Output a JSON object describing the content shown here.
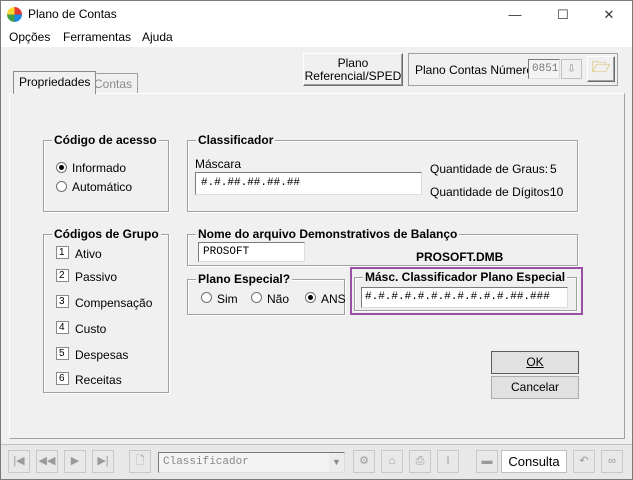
{
  "window": {
    "title": "Plano de Contas",
    "minimize_glyph": "—",
    "maximize_glyph": "☐",
    "close_glyph": "✕"
  },
  "menu": [
    "Opções",
    "Ferramentas",
    "Ajuda"
  ],
  "toolbar": {
    "ref_button_line1": "Plano",
    "ref_button_line2": "Referencial/SPED",
    "numero_label": "Plano Contas Número",
    "numero_value": "0851"
  },
  "tabs": [
    {
      "label": "Propriedades",
      "active": true
    },
    {
      "label": "Contas",
      "active": false
    }
  ],
  "codigo_acesso": {
    "title": "Código de acesso",
    "options": [
      {
        "label": "Informado",
        "checked": true
      },
      {
        "label": "Automático",
        "checked": false
      }
    ]
  },
  "classificador": {
    "title": "Classificador",
    "mascara_label": "Máscara",
    "mascara_value": "#.#.##.##.##.##",
    "graus_label": "Quantidade de Graus:",
    "graus_value": "5",
    "digitos_label": "Quantidade de Dígitos:",
    "digitos_value": "10"
  },
  "codigos_grupo": {
    "title": "Códigos de Grupo",
    "items": [
      {
        "num": "1",
        "label": "Ativo"
      },
      {
        "num": "2",
        "label": "Passivo"
      },
      {
        "num": "3",
        "label": "Compensação"
      },
      {
        "num": "4",
        "label": "Custo"
      },
      {
        "num": "5",
        "label": "Despesas"
      },
      {
        "num": "6",
        "label": "Receitas"
      }
    ]
  },
  "demonstrativos": {
    "title": "Nome do arquivo Demonstrativos de Balanço",
    "input_value": "PROSOFT",
    "file_name": "PROSOFT.DMB"
  },
  "plano_especial": {
    "title": "Plano Especial?",
    "options": [
      {
        "label": "Sim",
        "checked": false
      },
      {
        "label": "Não",
        "checked": false
      },
      {
        "label": "ANS",
        "checked": true
      }
    ]
  },
  "masc_especial": {
    "title": "Másc. Classificador Plano Especial",
    "value": "#.#.#.#.#.#.#.#.#.#.#.##.###"
  },
  "buttons": {
    "ok": "OK",
    "cancel": "Cancelar"
  },
  "statusbar": {
    "combo_value": "Classificador",
    "mode_label": "Consulta"
  },
  "colors": {
    "highlight": "#9b4fa6"
  }
}
